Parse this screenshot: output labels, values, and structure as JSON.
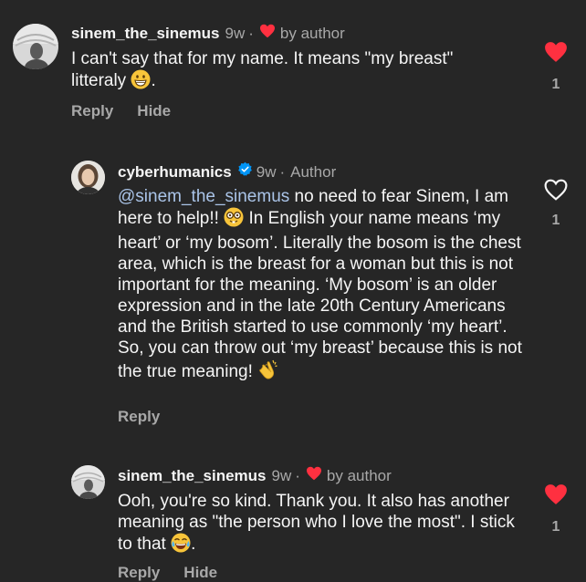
{
  "comments": [
    {
      "username": "sinem_the_sinemus",
      "time": "9w",
      "tag": "by author",
      "text": "I can't say that for my name. It means \"my breast\" litteraly",
      "end_punct": ".",
      "reply_label": "Reply",
      "hide_label": "Hide",
      "likes": "1",
      "liked": true
    },
    {
      "username": "cyberhumanics",
      "time": "9w",
      "tag": "Author",
      "mention": "@sinem_the_sinemus",
      "text_a": " no need to fear Sinem, I am here to help!!",
      "text_b": " In English your name means ‘my heart’ or ‘my bosom’. Literally the bosom is the chest area, which is the breast for a woman but this is not important for the meaning. ‘My bosom’ is an older expression and in the late 20th Century Americans and the British started to use commonly ‘my heart’. So, you can throw out ‘my breast’ because this is not the true meaning!",
      "reply_label": "Reply",
      "likes": "1",
      "liked": false
    },
    {
      "username": "sinem_the_sinemus",
      "time": "9w",
      "tag": "by author",
      "text": "Ooh, you're so kind. Thank you. It also has another meaning as \"the person who I love the most\". I stick to that",
      "end_punct": ".",
      "reply_label": "Reply",
      "hide_label": "Hide",
      "likes": "1",
      "liked": true
    }
  ],
  "colors": {
    "background": "#262626",
    "text": "#f5f5f5",
    "muted": "#a8a8a8",
    "like": "#ff3040",
    "mention": "#aac4e8",
    "verified": "#0095f6"
  }
}
